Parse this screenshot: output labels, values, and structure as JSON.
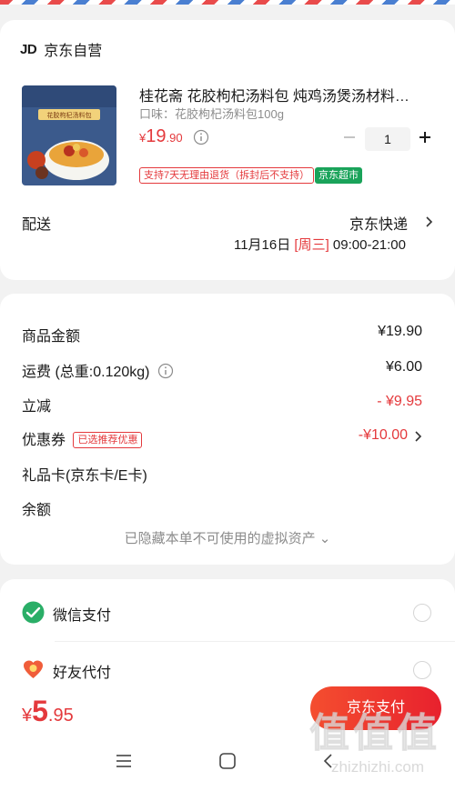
{
  "shop": {
    "logo": "JD",
    "name": "京东自营"
  },
  "product": {
    "title": "桂花斋 花胶枸杞汤料包 炖鸡汤煲汤材料…",
    "variant": "口味：花胶枸杞汤料包100g",
    "price_currency": "¥",
    "price_int": "19",
    "price_dec": ".90",
    "quantity": "1",
    "tag_return": "支持7天无理由退货（拆封后不支持）",
    "tag_market": "京东超市",
    "image_label": "花胶枸杞汤料包"
  },
  "delivery": {
    "label": "配送",
    "carrier": "京东快递",
    "date": "11月16日",
    "weekday": "[周三]",
    "time": "09:00-21:00"
  },
  "summary": {
    "goods_label": "商品金额",
    "goods_value": "¥19.90",
    "shipping_label": "运费 (总重:0.120kg)",
    "shipping_value": "¥6.00",
    "discount_label": "立减",
    "discount_value": "- ¥9.95",
    "coupon_label": "优惠券",
    "coupon_tag": "已选推荐优惠",
    "coupon_value": "-¥10.00",
    "giftcard_label": "礼品卡(京东卡/E卡)",
    "balance_label": "余额",
    "hidden_assets": "已隐藏本单不可使用的虚拟资产 ⌄"
  },
  "payment": {
    "wechat": "微信支付",
    "friend": "好友代付"
  },
  "checkout": {
    "currency": "¥",
    "total_int": "5",
    "total_dec": ".95",
    "pay_button": "京东支付"
  },
  "watermark": {
    "chars": [
      "值",
      "值",
      "值"
    ],
    "url": "zhizhizhi.com"
  },
  "colors": {
    "accent": "#e4393c",
    "market": "#1aa35a",
    "wechat": "#2aae67"
  }
}
